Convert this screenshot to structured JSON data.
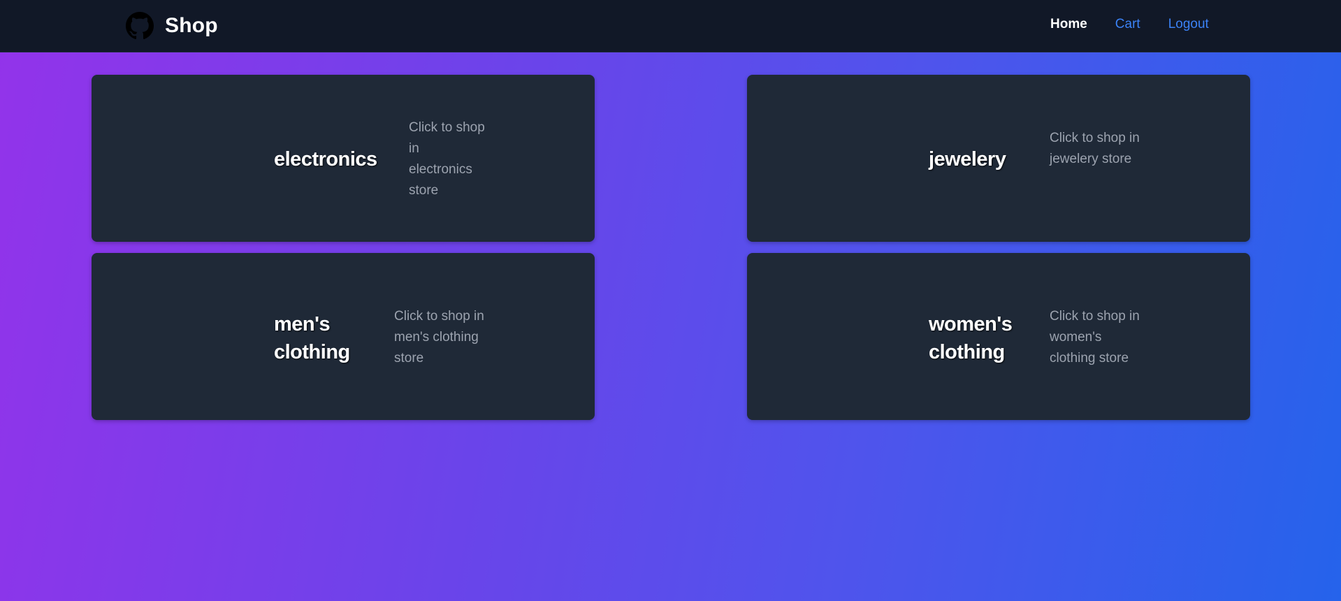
{
  "navbar": {
    "brand_icon": "github-icon",
    "brand_title": "Shop",
    "links": [
      {
        "label": "Home",
        "active": true
      },
      {
        "label": "Cart",
        "active": false
      },
      {
        "label": "Logout",
        "active": false
      }
    ]
  },
  "categories": [
    {
      "title": "electronics",
      "description": "Click to shop in electronics store"
    },
    {
      "title": "jewelery",
      "description": "Click to shop in jewelery store"
    },
    {
      "title": "men's clothing",
      "description": "Click to shop in men's clothing store"
    },
    {
      "title": "women's clothing",
      "description": "Click to shop in women's clothing store"
    }
  ],
  "colors": {
    "navbar_bg": "#111827",
    "card_bg": "#1f2937",
    "link_blue": "#3b82f6",
    "gradient_start": "#9333ea",
    "gradient_end": "#2563eb"
  }
}
